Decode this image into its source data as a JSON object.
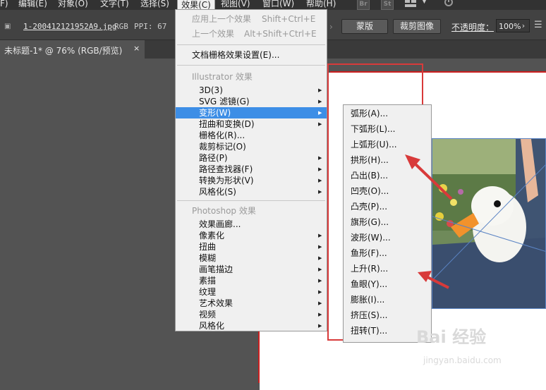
{
  "menubar": {
    "items": [
      {
        "label": "F)"
      },
      {
        "label": "编辑(E)"
      },
      {
        "label": "对象(O)"
      },
      {
        "label": "文字(T)"
      },
      {
        "label": "选择(S)"
      },
      {
        "label": "效果(C)"
      },
      {
        "label": "视图(V)"
      },
      {
        "label": "窗口(W)"
      },
      {
        "label": "帮助(H)"
      }
    ],
    "icons": [
      "Br",
      "St"
    ]
  },
  "control_bar": {
    "filename": "1-200412121952A9.jpg",
    "color_mode": "RGB",
    "ppi": "PPI: 67",
    "mask_button": "蒙版",
    "crop_button": "裁剪图像",
    "opacity_label": "不透明度：",
    "opacity_value": "100%"
  },
  "document_tab": {
    "title": "未标题-1* @ 76% (RGB/预览)",
    "close": "×"
  },
  "effect_menu": {
    "recent_items": [
      {
        "label": "应用上一个效果",
        "shortcut": "Shift+Ctrl+E"
      },
      {
        "label": "上一个效果",
        "shortcut": "Alt+Shift+Ctrl+E"
      }
    ],
    "raster_settings": "文档栅格效果设置(E)...",
    "illustrator_header": "Illustrator 效果",
    "illustrator_items": [
      {
        "label": "3D(3)"
      },
      {
        "label": "SVG 滤镜(G)"
      },
      {
        "label": "变形(W)"
      },
      {
        "label": "扭曲和变换(D)"
      },
      {
        "label": "栅格化(R)..."
      },
      {
        "label": "裁剪标记(O)"
      },
      {
        "label": "路径(P)"
      },
      {
        "label": "路径查找器(F)"
      },
      {
        "label": "转换为形状(V)"
      },
      {
        "label": "风格化(S)"
      }
    ],
    "photoshop_header": "Photoshop 效果",
    "photoshop_items": [
      {
        "label": "效果画廊..."
      },
      {
        "label": "像素化"
      },
      {
        "label": "扭曲"
      },
      {
        "label": "模糊"
      },
      {
        "label": "画笔描边"
      },
      {
        "label": "素描"
      },
      {
        "label": "纹理"
      },
      {
        "label": "艺术效果"
      },
      {
        "label": "视频"
      },
      {
        "label": "风格化"
      }
    ]
  },
  "warp_submenu": {
    "items": [
      {
        "label": "弧形(A)..."
      },
      {
        "label": "下弧形(L)..."
      },
      {
        "label": "上弧形(U)..."
      },
      {
        "label": "拱形(H)..."
      },
      {
        "label": "凸出(B)..."
      },
      {
        "label": "凹壳(O)..."
      },
      {
        "label": "凸壳(P)..."
      },
      {
        "label": "旗形(G)..."
      },
      {
        "label": "波形(W)..."
      },
      {
        "label": "鱼形(F)..."
      },
      {
        "label": "上升(R)..."
      },
      {
        "label": "鱼眼(Y)..."
      },
      {
        "label": "膨胀(I)..."
      },
      {
        "label": "挤压(S)..."
      },
      {
        "label": "扭转(T)..."
      }
    ]
  },
  "watermark": {
    "brand": "Bai 经验",
    "url": "jingyan.baidu.com"
  },
  "colors": {
    "highlight": "#3d8ee6",
    "annotation_red": "#d83a3a",
    "ui_dark": "#535353"
  }
}
